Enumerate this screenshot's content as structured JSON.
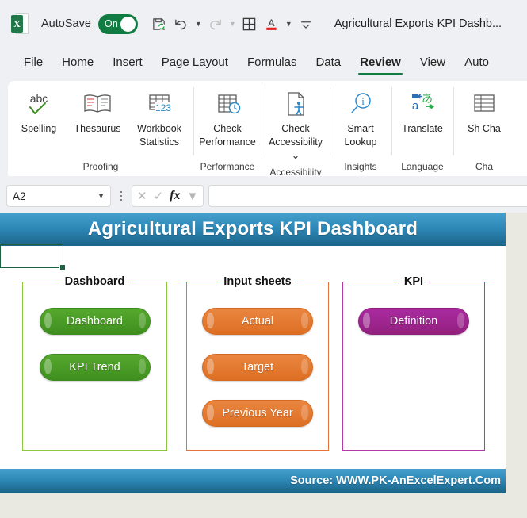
{
  "window": {
    "app_icon": "excel-icon",
    "autosave_label": "AutoSave",
    "autosave_state": "On",
    "title": "Agricultural Exports KPI Dashb...",
    "qat": [
      {
        "name": "save-icon",
        "label": "Save"
      },
      {
        "name": "undo-icon",
        "label": "Undo"
      },
      {
        "name": "redo-icon",
        "label": "Redo"
      },
      {
        "name": "borders-icon",
        "label": "Borders"
      },
      {
        "name": "font-color-icon",
        "label": "Font Color"
      },
      {
        "name": "customize-quick-access-toolbar-icon",
        "label": "Customize Quick Access Toolbar"
      }
    ]
  },
  "ribbon": {
    "tabs": [
      {
        "label": "File",
        "active": false
      },
      {
        "label": "Home",
        "active": false
      },
      {
        "label": "Insert",
        "active": false
      },
      {
        "label": "Page Layout",
        "active": false
      },
      {
        "label": "Formulas",
        "active": false
      },
      {
        "label": "Data",
        "active": false
      },
      {
        "label": "Review",
        "active": true
      },
      {
        "label": "View",
        "active": false
      },
      {
        "label": "Auto",
        "active": false
      }
    ],
    "groups": [
      {
        "label": "Proofing",
        "items": [
          {
            "label": "Spelling",
            "icon": "spelling-icon"
          },
          {
            "label": "Thesaurus",
            "icon": "thesaurus-icon"
          },
          {
            "label": "Workbook Statistics",
            "icon": "workbook-statistics-icon"
          }
        ]
      },
      {
        "label": "Performance",
        "items": [
          {
            "label": "Check Performance",
            "icon": "check-performance-icon"
          }
        ]
      },
      {
        "label": "Accessibility",
        "items": [
          {
            "label": "Check Accessibility",
            "icon": "check-accessibility-icon",
            "dropdown": true
          }
        ]
      },
      {
        "label": "Insights",
        "items": [
          {
            "label": "Smart Lookup",
            "icon": "smart-lookup-icon"
          }
        ]
      },
      {
        "label": "Language",
        "items": [
          {
            "label": "Translate",
            "icon": "translate-icon"
          }
        ]
      },
      {
        "label": "Cha",
        "items": [
          {
            "label": "Sh Cha",
            "icon": "show-changes-icon"
          }
        ]
      }
    ]
  },
  "formula_bar": {
    "name_box_value": "A2",
    "cancel_icon": "cancel-icon",
    "enter_icon": "enter-icon",
    "fx_icon": "insert-function-icon",
    "formula_value": "",
    "formula_placeholder": ""
  },
  "sheet": {
    "banner_title": "Agricultural Exports KPI Dashboard",
    "selected_cell": "A2",
    "footer_source": "Source: WWW.PK-AnExcelExpert.Com",
    "groups": [
      {
        "title": "Dashboard",
        "color": "#8dc63f",
        "style": "green",
        "buttons": [
          {
            "label": "Dashboard"
          },
          {
            "label": "KPI Trend"
          }
        ]
      },
      {
        "title": "Input sheets",
        "color": "#e8703a",
        "style": "orange",
        "buttons": [
          {
            "label": "Actual"
          },
          {
            "label": "Target"
          },
          {
            "label": "Previous Year"
          }
        ]
      },
      {
        "title": "KPI",
        "color": "#b338a8",
        "style": "purple",
        "buttons": [
          {
            "label": "Definition"
          }
        ]
      }
    ]
  }
}
